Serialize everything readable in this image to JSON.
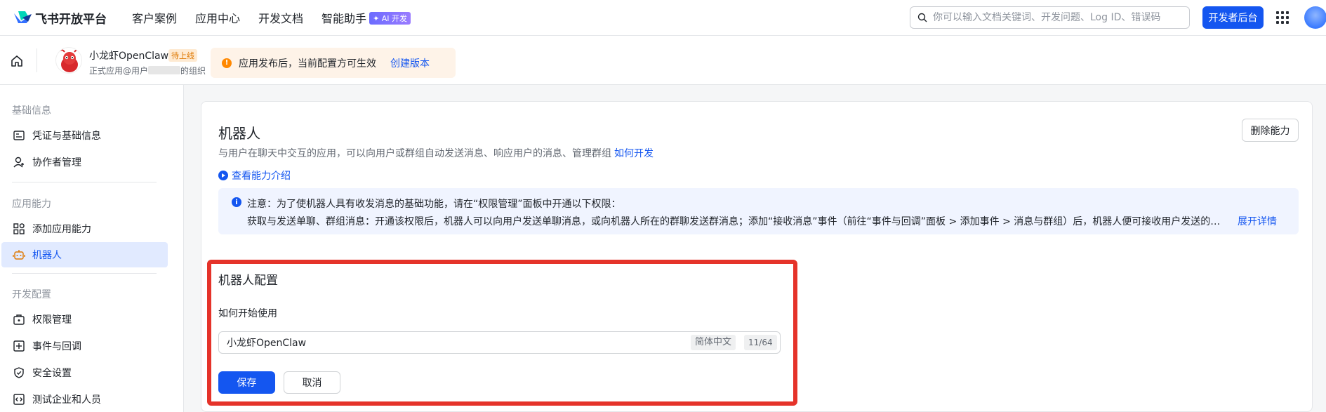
{
  "topnav": {
    "logo_text": "飞书开放平台",
    "items": [
      "客户案例",
      "应用中心",
      "开发文档",
      "智能助手"
    ],
    "ai_badge": "✦ AI 开发",
    "search_placeholder": "你可以输入文档关键词、开发问题、Log ID、错误码",
    "dev_console": "开发者后台"
  },
  "appbar": {
    "app_name": "小龙虾OpenClaw",
    "app_tag": "待上线",
    "app_sub_prefix": "正式应用@用户",
    "app_sub_suffix": "的组织",
    "notice_text": "应用发布后，当前配置方可生效",
    "notice_link": "创建版本"
  },
  "sidebar": {
    "group1": "基础信息",
    "items1": [
      "凭证与基础信息",
      "协作者管理"
    ],
    "group2": "应用能力",
    "items2": [
      "添加应用能力",
      "机器人"
    ],
    "group3": "开发配置",
    "items3": [
      "权限管理",
      "事件与回调",
      "安全设置",
      "测试企业和人员"
    ]
  },
  "main": {
    "title": "机器人",
    "desc": "与用户在聊天中交互的应用，可以向用户或群组自动发送消息、响应用户的消息、管理群组",
    "how_dev": "如何开发",
    "intro_link": "查看能力介绍",
    "delete_btn": "删除能力",
    "info_line1": "注意：为了使机器人具有收发消息的基础功能，请在“权限管理”面板中开通以下权限：",
    "info_line2": "获取与发送单聊、群组消息：开通该权限后，机器人可以向用户发送单聊消息，或向机器人所在的群聊发送群消息；添加“接收消息”事件（前往“事件与回调”面板 > 添加事件 > 消息与群组）后，机器人便可接收用户发送的单聊...",
    "info_expand": "展开详情"
  },
  "config": {
    "title": "机器人配置",
    "label": "如何开始使用",
    "input_value": "小龙虾OpenClaw",
    "lang": "简体中文",
    "count": "11/64",
    "save": "保存",
    "cancel": "取消"
  },
  "colors": {
    "primary": "#1456f0",
    "highlight": "#e5332a",
    "warning": "#ff8800"
  }
}
